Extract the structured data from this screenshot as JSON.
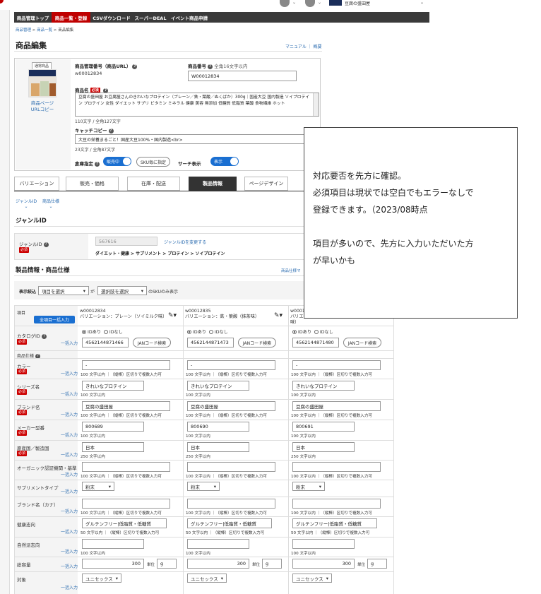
{
  "topnav": {
    "tabs": [
      {
        "label": "商品管理トップ",
        "active": false
      },
      {
        "label": "商品一覧・登録",
        "active": true
      },
      {
        "label": "CSVダウンロード",
        "active": false
      },
      {
        "label": "スーパーDEAL",
        "active": false
      },
      {
        "label": "イベント商品申請",
        "active": false
      }
    ],
    "store_name": "豆腐の盛田屋"
  },
  "breadcrumb": [
    "商品管理",
    "商品一覧",
    "商品編集"
  ],
  "page_title": "商品編集",
  "help_links": {
    "manual": "マニュアル",
    "overview": "概要"
  },
  "product": {
    "badge": "通常商品",
    "page_link": "商品ページ\nURLコピー",
    "mgmt_no_label": "商品管理番号（商品URL）",
    "mgmt_no": "w00012834",
    "item_no_label": "商品番号",
    "item_no_hint": "全角16文字以内",
    "item_no": "W00012834",
    "name_label": "商品名",
    "required": "必須",
    "name_value": "豆腐の盛田屋 お豆腐屋さんのきれいなプロテイン（プレーン／鉄・葉酸／ぬくばか）300g｜国産大豆 国内製造 ソイプロテイン プロテイン 女性 ダイエット サプリ ビタミン ミネラル 健康 美容 無添加 低糖質 低脂質 葉酸 食物繊維 ホット",
    "name_count": "110文字 / 全角127文字",
    "catch_label": "キャッチコピー",
    "catch_value": "大豆の栄養まるごと！国産大豆100%・国内製造<br>",
    "catch_count": "23文字 / 全角87文字",
    "warehouse_label": "倉庫指定",
    "warehouse_toggle": "販売中",
    "sku_button": "SKU毎に指定",
    "search_label": "サーチ表示",
    "search_toggle": "表示"
  },
  "subtabs": [
    "バリエーション",
    "販売・価格",
    "在庫・配送",
    "製品情報",
    "ページデザイン"
  ],
  "active_subtab": "製品情報",
  "jump_links": [
    "ジャンルID",
    "商品仕様"
  ],
  "genre": {
    "section_title": "ジャンルID",
    "label": "ジャンルID",
    "required": "必須",
    "value": "567616",
    "change_link": "ジャンルIDを変更する",
    "path": "ダイエット・健康 > サプリメント > プロテイン > ソイプロテイン"
  },
  "spec": {
    "section_title": "製品情報・商品仕様",
    "side_link": "商品仕様マ",
    "filter_label": "表示絞込",
    "filter_item": "項目を選択",
    "filter_ga": "が",
    "filter_option": "選択肢を選択",
    "filter_suffix": "のSKUのみ表示",
    "item_header": "項目",
    "bulk_all": "全項目一括入力",
    "bulk": "一括入力",
    "spec_group": "商品仕様",
    "skus": [
      {
        "id": "w00012834",
        "variation": "バリエーション：プレーン（ソイミルク味）",
        "jan": "4562144871466"
      },
      {
        "id": "w00012835",
        "variation": "バリエーション：鉄・葉酸（抹茶味）",
        "jan": "4562144871473"
      },
      {
        "id": "w00012",
        "variation": "バリエー\n味）",
        "jan": "4562144871480"
      }
    ],
    "catalog_label": "カタログID",
    "id_yes": "IDあり",
    "id_no": "IDなし",
    "jan_button": "JANコード検索",
    "rows": [
      {
        "label": "カラー",
        "required": true,
        "values": [
          "-",
          "-",
          "-"
        ],
        "hint": "100 文字以内 ｜（縦棒）区切りで複数入力可"
      },
      {
        "label": "シリーズ名",
        "required": true,
        "values": [
          "きれいなプロテイン",
          "きれいなプロテイン",
          "きれいなプロテイン"
        ],
        "hint": "100 文字以内"
      },
      {
        "label": "ブランド名",
        "required": true,
        "values": [
          "豆腐の盛田屋",
          "豆腐の盛田屋",
          "豆腐の盛田屋"
        ],
        "hint": "100 文字以内 ｜（縦棒）区切りで複数入力可"
      },
      {
        "label": "メーカー型番",
        "required": true,
        "values": [
          "800689",
          "800690",
          "800691"
        ],
        "hint": "100 文字以内"
      },
      {
        "label": "原産国／製造国",
        "required": true,
        "values": [
          "日本",
          "日本",
          "日本"
        ],
        "hint": "250 文字以内"
      },
      {
        "label": "オーガニック認証機関・基準",
        "required": false,
        "values": [
          "",
          "",
          ""
        ],
        "hint": "100 文字以内 ｜（縦棒）区切りで複数入力可"
      },
      {
        "label": "サプリメントタイプ",
        "required": false,
        "values": [
          "粉末",
          "粉末",
          "粉末"
        ],
        "hint": ""
      },
      {
        "label": "ブランド名（カナ）",
        "required": false,
        "values": [
          "",
          "",
          ""
        ],
        "hint": "100 文字以内 ｜（縦棒）区切りで複数入力可"
      },
      {
        "label": "健康志向",
        "required": false,
        "values": [
          "グルテンフリー|低脂質・低糖質",
          "グルテンフリー|低脂質・低糖質",
          "グルテンフリー|低脂質・低糖質"
        ],
        "hint": "50 文字以内 ｜（縦棒）区切りで複数入力可"
      },
      {
        "label": "自然派志向",
        "required": false,
        "values": [
          "",
          "",
          ""
        ],
        "hint": "100 文字以内"
      },
      {
        "label": "総容量",
        "required": false,
        "values": [
          "300",
          "300",
          "300"
        ],
        "unit_label": "単位",
        "unit": "g"
      },
      {
        "label": "対象",
        "required": false,
        "values": [
          "ユニセックス",
          "ユニセックス",
          "ユニセックス"
        ],
        "hint": ""
      }
    ]
  },
  "note": {
    "lines": [
      "対応要否を先方に確認。",
      "必須項目は現状では空白でもエラーなしで",
      "登録できます。（2023/08時点",
      "",
      "項目が多いので、先方に入力いただいた方",
      "が早いかも"
    ]
  },
  "colors": {
    "nav_bg": "#3a3a3a",
    "nav_active": "#bf0000",
    "accent": "#1a6fd1",
    "required": "#c00000"
  }
}
